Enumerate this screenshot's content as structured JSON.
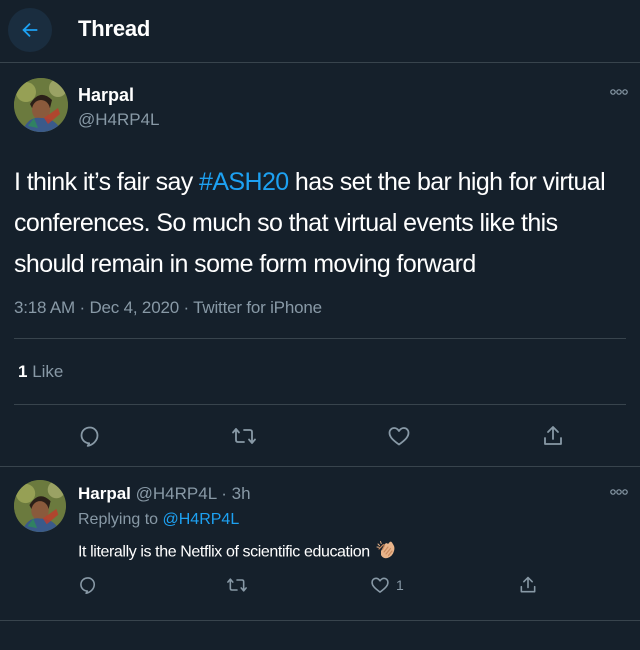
{
  "header": {
    "title": "Thread",
    "back_icon": "arrow-left-icon",
    "accent_color": "#1da1f2"
  },
  "main_tweet": {
    "author_name": "Harpal",
    "author_handle": "@H4RP4L",
    "more_icon": "more-horizontal-icon",
    "text_before": "I think it’s fair say ",
    "hashtag": "#ASH20",
    "text_after": " has set the bar high for virtual conferences.  So much so that virtual events like this should remain in some form moving forward",
    "meta": "3:18 AM · Dec 4, 2020 · Twitter for iPhone",
    "likes_count": "1",
    "likes_label": " Like",
    "actions": [
      "reply-icon",
      "retweet-icon",
      "like-icon",
      "share-icon"
    ]
  },
  "reply_tweet": {
    "author_name": "Harpal",
    "author_meta": " @H4RP4L · 3h",
    "replying_label": "Replying to ",
    "replying_handle": "@H4RP4L",
    "text": "It literally is the Netflix of scientific education",
    "emoji_icon": "clapping-hands-icon",
    "like_count": "1",
    "more_icon": "more-horizontal-icon",
    "actions": [
      "reply-icon",
      "retweet-icon",
      "like-icon",
      "share-icon"
    ]
  },
  "colors": {
    "background": "#15202b",
    "text_primary": "#ffffff",
    "text_secondary": "#8899a6",
    "divider": "#38444d",
    "link": "#1da1f2"
  }
}
